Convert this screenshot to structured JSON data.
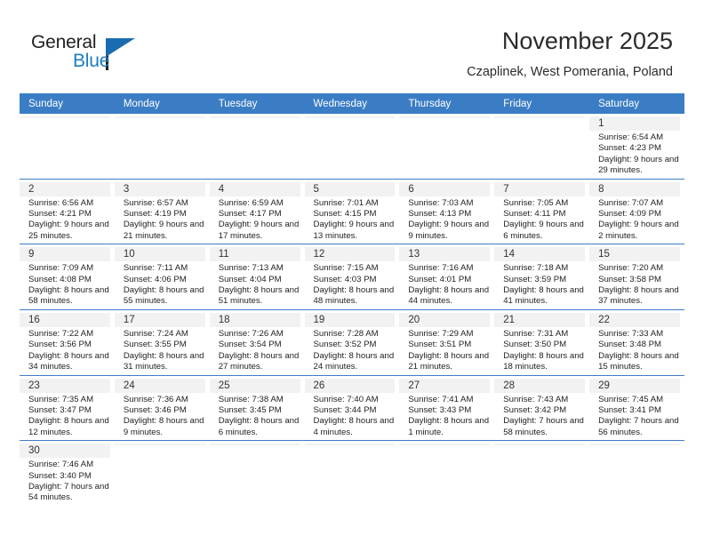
{
  "logo": {
    "word1": "General",
    "word2": "Blue",
    "triangle_color": "#1a6cb0"
  },
  "header": {
    "title": "November 2025",
    "subtitle": "Czaplinek, West Pomerania, Poland"
  },
  "theme": {
    "header_blue": "#3b7dc4",
    "daynum_bg": "#f2f2f2"
  },
  "weekdays": [
    "Sunday",
    "Monday",
    "Tuesday",
    "Wednesday",
    "Thursday",
    "Friday",
    "Saturday"
  ],
  "labels": {
    "sunrise": "Sunrise:",
    "sunset": "Sunset:",
    "daylight": "Daylight:"
  },
  "weeks": [
    [
      {
        "day": "",
        "text": ""
      },
      {
        "day": "",
        "text": ""
      },
      {
        "day": "",
        "text": ""
      },
      {
        "day": "",
        "text": ""
      },
      {
        "day": "",
        "text": ""
      },
      {
        "day": "",
        "text": ""
      },
      {
        "day": "1",
        "text": "Sunrise: 6:54 AM\nSunset: 4:23 PM\nDaylight: 9 hours and 29 minutes."
      }
    ],
    [
      {
        "day": "2",
        "text": "Sunrise: 6:56 AM\nSunset: 4:21 PM\nDaylight: 9 hours and 25 minutes."
      },
      {
        "day": "3",
        "text": "Sunrise: 6:57 AM\nSunset: 4:19 PM\nDaylight: 9 hours and 21 minutes."
      },
      {
        "day": "4",
        "text": "Sunrise: 6:59 AM\nSunset: 4:17 PM\nDaylight: 9 hours and 17 minutes."
      },
      {
        "day": "5",
        "text": "Sunrise: 7:01 AM\nSunset: 4:15 PM\nDaylight: 9 hours and 13 minutes."
      },
      {
        "day": "6",
        "text": "Sunrise: 7:03 AM\nSunset: 4:13 PM\nDaylight: 9 hours and 9 minutes."
      },
      {
        "day": "7",
        "text": "Sunrise: 7:05 AM\nSunset: 4:11 PM\nDaylight: 9 hours and 6 minutes."
      },
      {
        "day": "8",
        "text": "Sunrise: 7:07 AM\nSunset: 4:09 PM\nDaylight: 9 hours and 2 minutes."
      }
    ],
    [
      {
        "day": "9",
        "text": "Sunrise: 7:09 AM\nSunset: 4:08 PM\nDaylight: 8 hours and 58 minutes."
      },
      {
        "day": "10",
        "text": "Sunrise: 7:11 AM\nSunset: 4:06 PM\nDaylight: 8 hours and 55 minutes."
      },
      {
        "day": "11",
        "text": "Sunrise: 7:13 AM\nSunset: 4:04 PM\nDaylight: 8 hours and 51 minutes."
      },
      {
        "day": "12",
        "text": "Sunrise: 7:15 AM\nSunset: 4:03 PM\nDaylight: 8 hours and 48 minutes."
      },
      {
        "day": "13",
        "text": "Sunrise: 7:16 AM\nSunset: 4:01 PM\nDaylight: 8 hours and 44 minutes."
      },
      {
        "day": "14",
        "text": "Sunrise: 7:18 AM\nSunset: 3:59 PM\nDaylight: 8 hours and 41 minutes."
      },
      {
        "day": "15",
        "text": "Sunrise: 7:20 AM\nSunset: 3:58 PM\nDaylight: 8 hours and 37 minutes."
      }
    ],
    [
      {
        "day": "16",
        "text": "Sunrise: 7:22 AM\nSunset: 3:56 PM\nDaylight: 8 hours and 34 minutes."
      },
      {
        "day": "17",
        "text": "Sunrise: 7:24 AM\nSunset: 3:55 PM\nDaylight: 8 hours and 31 minutes."
      },
      {
        "day": "18",
        "text": "Sunrise: 7:26 AM\nSunset: 3:54 PM\nDaylight: 8 hours and 27 minutes."
      },
      {
        "day": "19",
        "text": "Sunrise: 7:28 AM\nSunset: 3:52 PM\nDaylight: 8 hours and 24 minutes."
      },
      {
        "day": "20",
        "text": "Sunrise: 7:29 AM\nSunset: 3:51 PM\nDaylight: 8 hours and 21 minutes."
      },
      {
        "day": "21",
        "text": "Sunrise: 7:31 AM\nSunset: 3:50 PM\nDaylight: 8 hours and 18 minutes."
      },
      {
        "day": "22",
        "text": "Sunrise: 7:33 AM\nSunset: 3:48 PM\nDaylight: 8 hours and 15 minutes."
      }
    ],
    [
      {
        "day": "23",
        "text": "Sunrise: 7:35 AM\nSunset: 3:47 PM\nDaylight: 8 hours and 12 minutes."
      },
      {
        "day": "24",
        "text": "Sunrise: 7:36 AM\nSunset: 3:46 PM\nDaylight: 8 hours and 9 minutes."
      },
      {
        "day": "25",
        "text": "Sunrise: 7:38 AM\nSunset: 3:45 PM\nDaylight: 8 hours and 6 minutes."
      },
      {
        "day": "26",
        "text": "Sunrise: 7:40 AM\nSunset: 3:44 PM\nDaylight: 8 hours and 4 minutes."
      },
      {
        "day": "27",
        "text": "Sunrise: 7:41 AM\nSunset: 3:43 PM\nDaylight: 8 hours and 1 minute."
      },
      {
        "day": "28",
        "text": "Sunrise: 7:43 AM\nSunset: 3:42 PM\nDaylight: 7 hours and 58 minutes."
      },
      {
        "day": "29",
        "text": "Sunrise: 7:45 AM\nSunset: 3:41 PM\nDaylight: 7 hours and 56 minutes."
      }
    ],
    [
      {
        "day": "30",
        "text": "Sunrise: 7:46 AM\nSunset: 3:40 PM\nDaylight: 7 hours and 54 minutes."
      },
      {
        "day": "",
        "text": ""
      },
      {
        "day": "",
        "text": ""
      },
      {
        "day": "",
        "text": ""
      },
      {
        "day": "",
        "text": ""
      },
      {
        "day": "",
        "text": ""
      },
      {
        "day": "",
        "text": ""
      }
    ]
  ]
}
